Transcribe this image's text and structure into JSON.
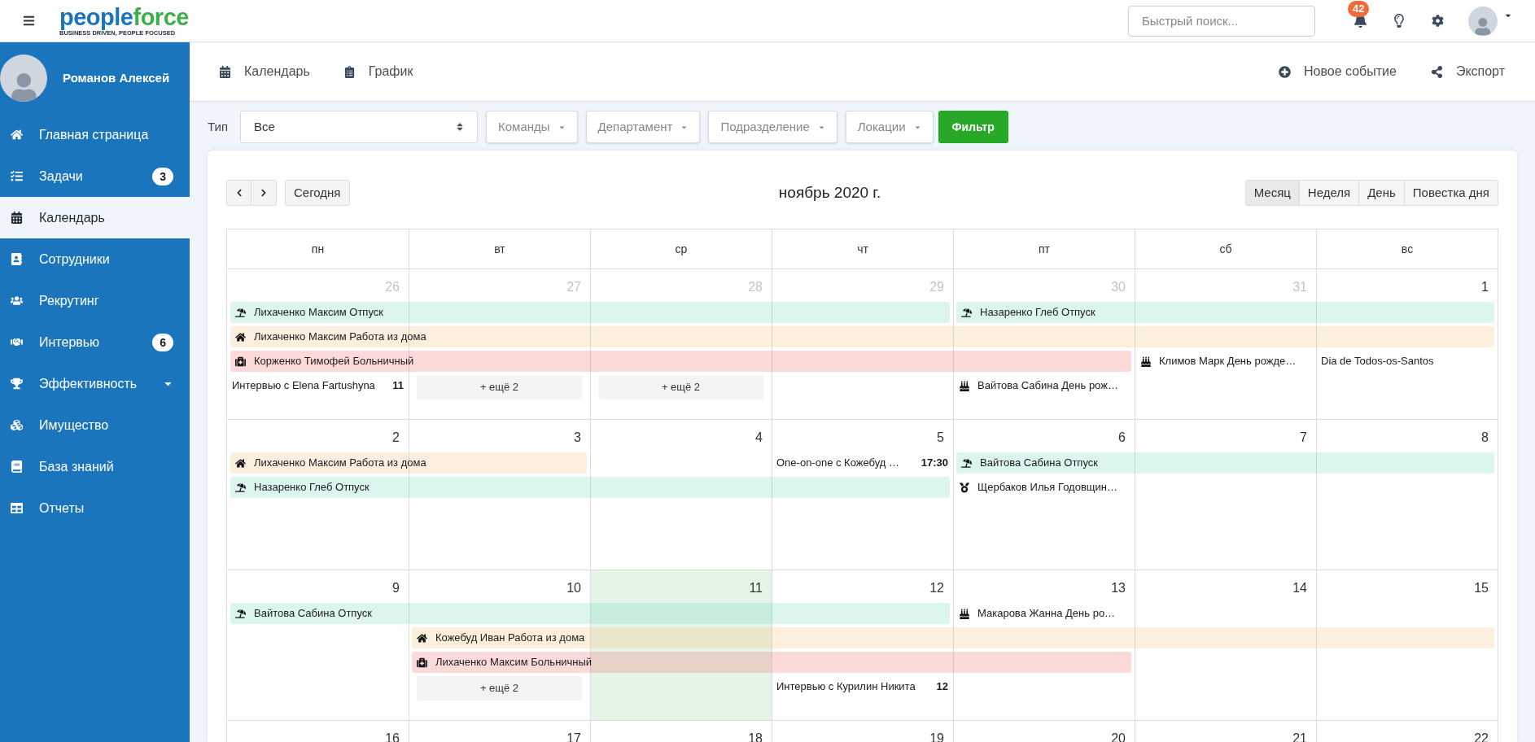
{
  "topbar": {
    "wordmark": [
      "people",
      "force"
    ],
    "tagline": "BUSINESS DRIVEN, PEOPLE FOCUSED",
    "search": {
      "placeholder": "Быстрый поиск..."
    },
    "notifications": "42"
  },
  "sidebar": {
    "user": "Романов Алексей",
    "items": [
      {
        "label": "Главная страница",
        "kind": "link",
        "selected": false
      },
      {
        "label": "Задачи",
        "kind": "link",
        "selected": false,
        "badge": "3"
      },
      {
        "label": "Календарь",
        "kind": "link",
        "selected": true
      },
      {
        "label": "Сотрудники",
        "kind": "link",
        "selected": false
      },
      {
        "label": "Рекрутинг",
        "kind": "link",
        "selected": false
      },
      {
        "label": "Интервью",
        "kind": "link",
        "selected": false,
        "badge": "6"
      },
      {
        "label": "Эффективность",
        "kind": "group",
        "selected": false
      },
      {
        "label": "Имущество",
        "kind": "link",
        "selected": false
      },
      {
        "label": "База знаний",
        "kind": "link",
        "selected": false
      },
      {
        "label": "Отчеты",
        "kind": "link",
        "selected": false
      }
    ]
  },
  "subnav": {
    "tabs": [
      "Календарь",
      "График"
    ],
    "actions": [
      "Новое событие",
      "Экспорт"
    ]
  },
  "filters": {
    "label": "Тип",
    "type_select": "Все",
    "dropdowns": [
      "Команды",
      "Департамент",
      "Подразделение",
      "Локации"
    ],
    "button": "Фильтр"
  },
  "calendar": {
    "today_button": "Сегодня",
    "title": "ноябрь 2020 г.",
    "views": [
      {
        "label": "Месяц",
        "selected": true
      },
      {
        "label": "Неделя",
        "selected": false
      },
      {
        "label": "День",
        "selected": false
      },
      {
        "label": "Повестка дня",
        "selected": false
      }
    ],
    "weekdays": [
      "пн",
      "вт",
      "ср",
      "чт",
      "пт",
      "сб",
      "вс"
    ],
    "weeks": [
      {
        "days": [
          {
            "label": "26",
            "muted": true,
            "today": false
          },
          {
            "label": "27",
            "muted": true,
            "today": false
          },
          {
            "label": "28",
            "muted": true,
            "today": false
          },
          {
            "label": "29",
            "muted": true,
            "today": false
          },
          {
            "label": "30",
            "muted": true,
            "today": false
          },
          {
            "label": "31",
            "muted": true,
            "today": false
          },
          {
            "label": "1",
            "muted": false,
            "today": false
          }
        ],
        "events": [
          {
            "kind": "vacation",
            "text": "Лихаченко Максим Отпуск"
          },
          {
            "kind": "vacation",
            "text": "Назаренко Глеб Отпуск"
          },
          {
            "kind": "remote",
            "text": "Лихаченко Максим Работа из дома"
          },
          {
            "kind": "sick",
            "text": "Корженко Тимофей Больничный"
          },
          {
            "kind": "birthday",
            "text": "Климов Марк День рожде…"
          },
          {
            "kind": "holiday",
            "text": "Dia de Todos-os-Santos"
          },
          {
            "kind": "meeting",
            "text": "Интервью с Elena Fartushyna",
            "time": "11"
          },
          {
            "kind": "more",
            "text": "+ ещё 2"
          },
          {
            "kind": "more",
            "text": "+ ещё 2"
          },
          {
            "kind": "birthday",
            "text": "Вайтова Сабина День рож…"
          }
        ]
      },
      {
        "days": [
          {
            "label": "2",
            "muted": false,
            "today": false
          },
          {
            "label": "3",
            "muted": false,
            "today": false
          },
          {
            "label": "4",
            "muted": false,
            "today": false
          },
          {
            "label": "5",
            "muted": false,
            "today": false
          },
          {
            "label": "6",
            "muted": false,
            "today": false
          },
          {
            "label": "7",
            "muted": false,
            "today": false
          },
          {
            "label": "8",
            "muted": false,
            "today": false
          }
        ],
        "events": [
          {
            "kind": "remote",
            "text": "Лихаченко Максим Работа из дома"
          },
          {
            "kind": "meeting",
            "text": "One-on-one с Кожебуд …",
            "time": "17:30"
          },
          {
            "kind": "vacation",
            "text": "Вайтова Сабина Отпуск"
          },
          {
            "kind": "vacation",
            "text": "Назаренко Глеб Отпуск"
          },
          {
            "kind": "anniversary",
            "text": "Щербаков Илья Годовщин…"
          }
        ]
      },
      {
        "days": [
          {
            "label": "9",
            "muted": false,
            "today": false
          },
          {
            "label": "10",
            "muted": false,
            "today": false
          },
          {
            "label": "11",
            "muted": false,
            "today": true
          },
          {
            "label": "12",
            "muted": false,
            "today": false
          },
          {
            "label": "13",
            "muted": false,
            "today": false
          },
          {
            "label": "14",
            "muted": false,
            "today": false
          },
          {
            "label": "15",
            "muted": false,
            "today": false
          }
        ],
        "events": [
          {
            "kind": "vacation",
            "text": "Вайтова Сабина Отпуск"
          },
          {
            "kind": "birthday",
            "text": "Макарова Жанна День ро…"
          },
          {
            "kind": "remote",
            "text": "Кожебуд Иван Работа из дома"
          },
          {
            "kind": "sick",
            "text": "Лихаченко Максим Больничный"
          },
          {
            "kind": "more",
            "text": "+ ещё 2"
          },
          {
            "kind": "meeting",
            "text": "Интервью с Курилин Никита",
            "time": "12"
          }
        ]
      },
      {
        "days": [
          {
            "label": "16",
            "muted": false,
            "today": false
          },
          {
            "label": "17",
            "muted": false,
            "today": false
          },
          {
            "label": "18",
            "muted": false,
            "today": false
          },
          {
            "label": "19",
            "muted": false,
            "today": false
          },
          {
            "label": "20",
            "muted": false,
            "today": false
          },
          {
            "label": "21",
            "muted": false,
            "today": false
          },
          {
            "label": "22",
            "muted": false,
            "today": false
          }
        ]
      }
    ]
  }
}
